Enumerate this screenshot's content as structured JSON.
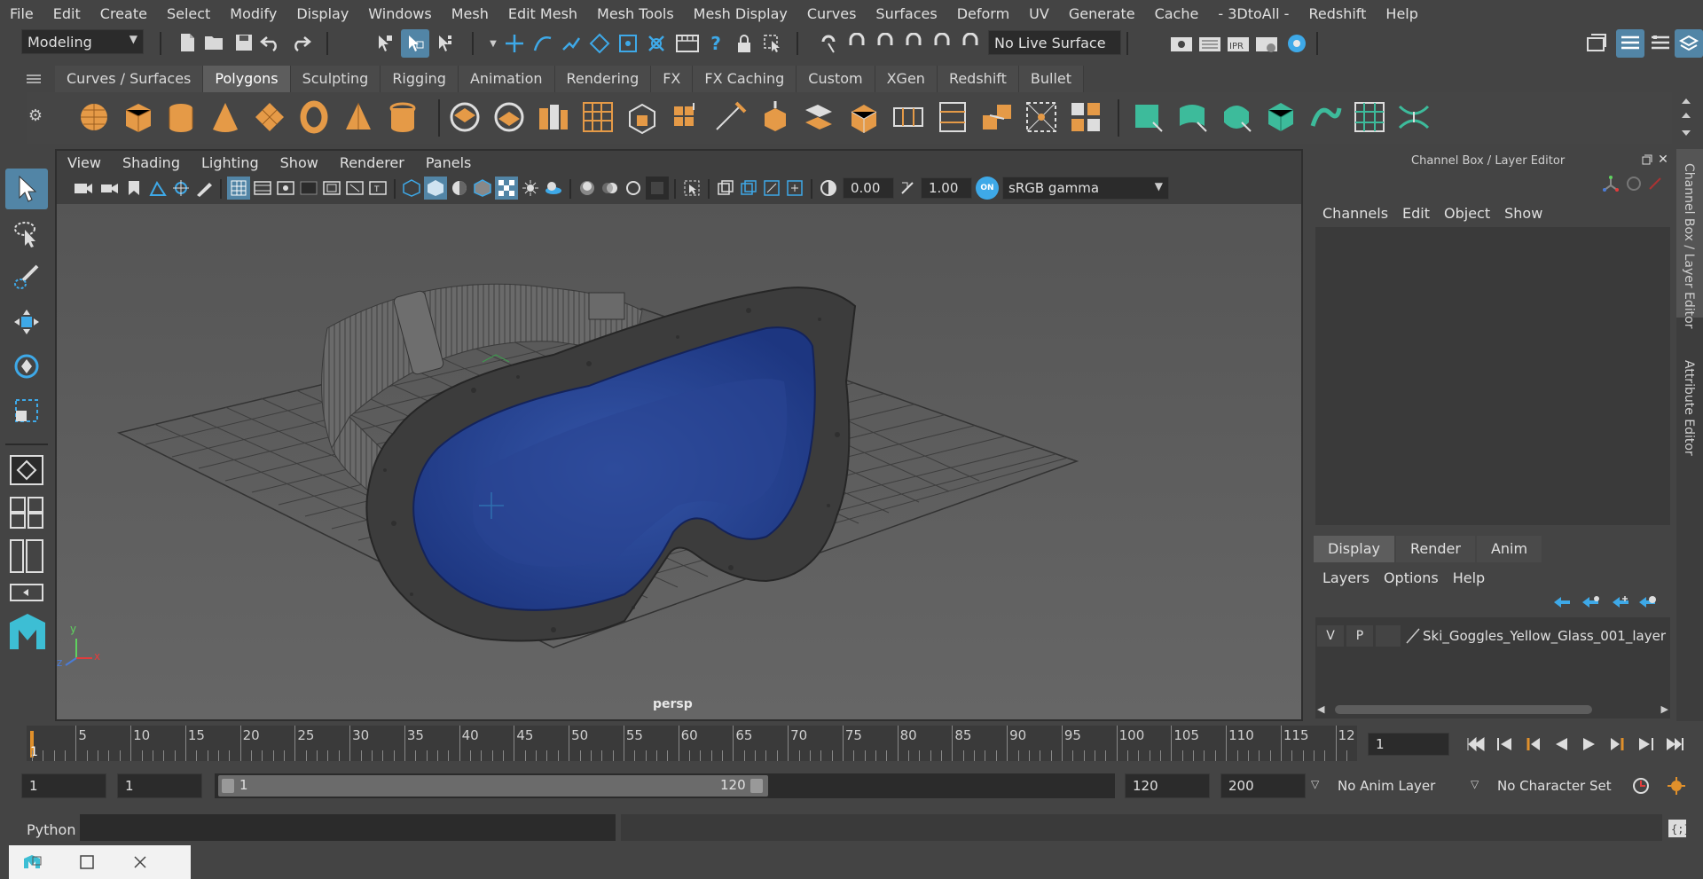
{
  "menubar": {
    "items": [
      "File",
      "Edit",
      "Create",
      "Select",
      "Modify",
      "Display",
      "Windows",
      "Mesh",
      "Edit Mesh",
      "Mesh Tools",
      "Mesh Display",
      "Curves",
      "Surfaces",
      "Deform",
      "UV",
      "Generate",
      "Cache",
      "- 3DtoAll -",
      "Redshift",
      "Help"
    ]
  },
  "status": {
    "mode": "Modeling",
    "live_surface": "No Live Surface"
  },
  "shelf": {
    "tabs": [
      "Curves / Surfaces",
      "Polygons",
      "Sculpting",
      "Rigging",
      "Animation",
      "Rendering",
      "FX",
      "FX Caching",
      "Custom",
      "XGen",
      "Redshift",
      "Bullet"
    ],
    "active_tab": "Polygons"
  },
  "viewport": {
    "menu": [
      "View",
      "Shading",
      "Lighting",
      "Show",
      "Renderer",
      "Panels"
    ],
    "exposure": "0.00",
    "gamma": "1.00",
    "color_space": "sRGB gamma",
    "camera_label": "persp",
    "axis_x": "x",
    "axis_y": "y",
    "axis_z": "z"
  },
  "channelbox": {
    "title": "Channel Box / Layer Editor",
    "menu": [
      "Channels",
      "Edit",
      "Object",
      "Show"
    ],
    "tabs": [
      "Display",
      "Render",
      "Anim"
    ],
    "active_tab": "Display",
    "layer_menu": [
      "Layers",
      "Options",
      "Help"
    ],
    "layer": {
      "v": "V",
      "p": "P",
      "name": "Ski_Goggles_Yellow_Glass_001_layer"
    }
  },
  "sidetabs": {
    "channel": "Channel Box / Layer Editor",
    "attribute": "Attribute Editor"
  },
  "timeline": {
    "labels": [
      "5",
      "10",
      "15",
      "20",
      "25",
      "30",
      "35",
      "40",
      "45",
      "50",
      "55",
      "60",
      "65",
      "70",
      "75",
      "80",
      "85",
      "90",
      "95",
      "100",
      "105",
      "110",
      "115",
      "12"
    ],
    "start_marker": "1",
    "current_frame": "1"
  },
  "range": {
    "start": "1",
    "playback_start": "1",
    "slider_start": "1",
    "slider_end": "120",
    "playback_end": "120",
    "end": "200",
    "anim_layer": "No Anim Layer",
    "character_set": "No Character Set"
  },
  "cmdline": {
    "language": "Python"
  },
  "colors": {
    "accent": "#5285a6",
    "shelf_orange": "#e59a47",
    "shelf_teal": "#3dbb9b",
    "lens_blue": "#26459c",
    "timeline_marker": "#e0902b"
  }
}
